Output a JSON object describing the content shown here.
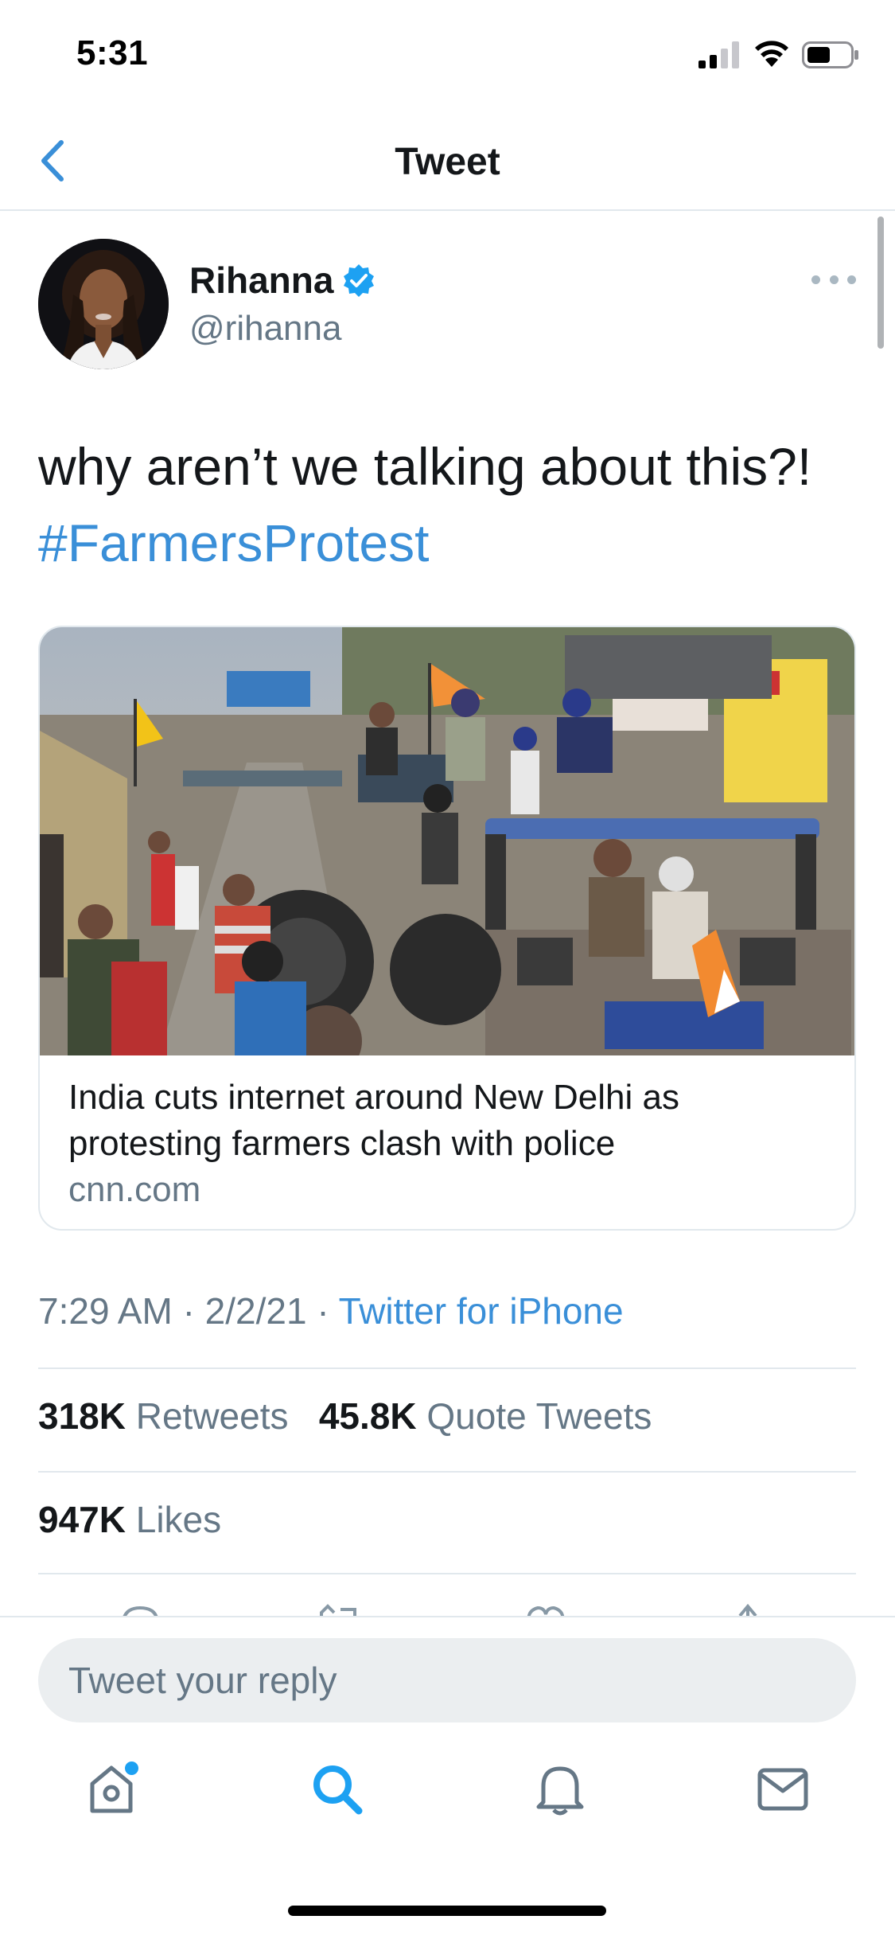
{
  "status_bar": {
    "time": "5:31"
  },
  "nav": {
    "title": "Tweet",
    "back_icon": "chevron-left-icon"
  },
  "author": {
    "name": "Rihanna",
    "handle": "@rihanna",
    "verified": true,
    "more_icon": "ellipsis-icon"
  },
  "tweet": {
    "text": "why aren’t we talking about this?!",
    "hashtag": "#FarmersProtest"
  },
  "card": {
    "title": "India cuts internet around New Delhi as protesting farmers clash with police",
    "domain": "cnn.com"
  },
  "meta": {
    "time": "7:29 AM",
    "date": "2/2/21",
    "separator": "·",
    "source": "Twitter for iPhone"
  },
  "stats": {
    "retweets_count": "318K",
    "retweets_label": "Retweets",
    "quotes_count": "45.8K",
    "quotes_label": "Quote Tweets",
    "likes_count": "947K",
    "likes_label": "Likes"
  },
  "reply": {
    "placeholder": "Tweet your reply"
  },
  "tabs": [
    {
      "icon": "home-icon",
      "active": false,
      "has_dot": true
    },
    {
      "icon": "search-icon",
      "active": true
    },
    {
      "icon": "bell-icon",
      "active": false
    },
    {
      "icon": "mail-icon",
      "active": false
    }
  ],
  "colors": {
    "accent": "#1da1f2",
    "link": "#3a8fd8",
    "text": "#14171a",
    "secondary": "#657786",
    "divider": "#e1e8ed"
  }
}
